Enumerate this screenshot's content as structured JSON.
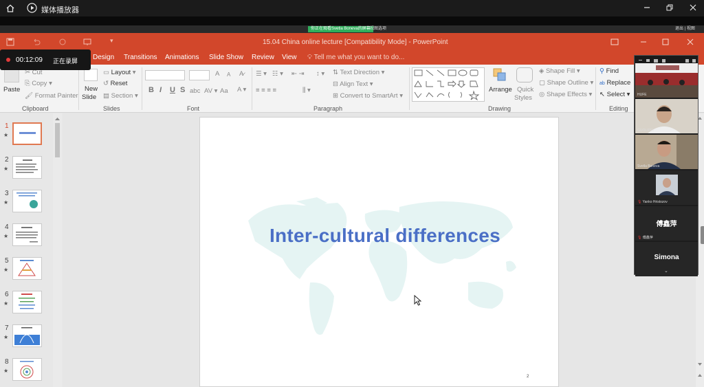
{
  "player": {
    "title": "媒体播放器",
    "window_buttons": [
      "minimize-icon",
      "restore-icon",
      "close-icon"
    ]
  },
  "meeting": {
    "share_status": "你正在观看Svetla Boneva的屏幕",
    "view_options": "视图选项",
    "right_text": "退出 | 视图"
  },
  "recording": {
    "time": "00:12:09",
    "label": "正在录屏"
  },
  "ppt": {
    "doc_title": "15.04 China online lecture [Compatibility Mode] - PowerPoint",
    "accent": "#d2472b",
    "tabs": [
      "Design",
      "Transitions",
      "Animations",
      "Slide Show",
      "Review",
      "View"
    ],
    "tell_me": "Tell me what you want to do...",
    "ribbon": {
      "clipboard": {
        "paste": "Paste",
        "cut": "Cut",
        "copy": "Copy",
        "format_painter": "Format Painter",
        "label": "Clipboard"
      },
      "slides": {
        "new_slide": "New",
        "new_slide_2": "Slide",
        "layout": "Layout",
        "reset": "Reset",
        "section": "Section",
        "label": "Slides"
      },
      "font": {
        "label": "Font",
        "bold": "B",
        "italic": "I",
        "underline": "U",
        "strike": "S",
        "grow": "A",
        "shrink": "A",
        "aa": "Aa"
      },
      "paragraph": {
        "text_direction": "Text Direction",
        "align_text": "Align Text",
        "convert_smartart": "Convert to SmartArt",
        "label": "Paragraph"
      },
      "drawing": {
        "arrange": "Arrange",
        "quick_styles": "Quick",
        "quick_styles_2": "Styles",
        "shape_fill": "Shape Fill",
        "shape_outline": "Shape Outline",
        "shape_effects": "Shape Effects",
        "label": "Drawing"
      },
      "editing": {
        "find": "Find",
        "replace": "Replace",
        "select": "Select",
        "label": "Editing"
      }
    },
    "thumbnails": [
      {
        "num": "1",
        "selected": true
      },
      {
        "num": "2",
        "selected": false
      },
      {
        "num": "3",
        "selected": false
      },
      {
        "num": "4",
        "selected": false
      },
      {
        "num": "5",
        "selected": false
      },
      {
        "num": "6",
        "selected": false
      },
      {
        "num": "7",
        "selected": false
      },
      {
        "num": "8",
        "selected": false
      }
    ],
    "slide": {
      "title": "Inter-cultural differences",
      "page_number": "2"
    }
  },
  "participants": [
    {
      "name": "HUFE",
      "kind": "video"
    },
    {
      "name": "GUOLIPEI",
      "kind": "video"
    },
    {
      "name": "Svetla Boneva",
      "kind": "video"
    },
    {
      "name": "Yanko Hristozov",
      "kind": "video"
    },
    {
      "name": "傅鑫萍",
      "kind": "name"
    },
    {
      "name": "Simona",
      "kind": "name"
    }
  ]
}
